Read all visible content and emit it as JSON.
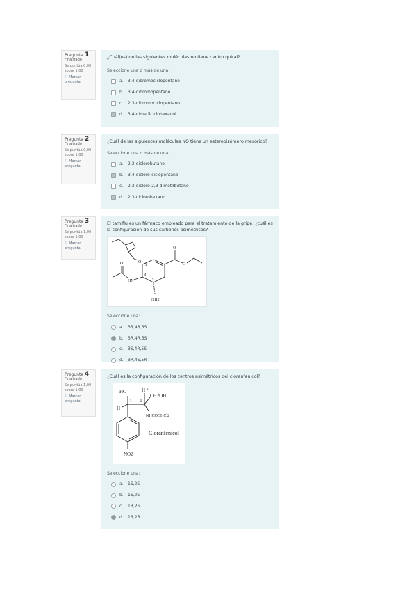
{
  "questions": [
    {
      "label": "Pregunta",
      "number": "1",
      "state": "Finalizado",
      "mark": "Se puntúa 0,00 sobre 1,00",
      "flag": "Marcar pregunta",
      "text": "¿Cuál(es) de las siguientes moléculas no tiene centro quiral?",
      "prompt": "Seleccione una o más de una:",
      "answers": [
        {
          "letter": "a.",
          "text": "3,4-dibromociclopentano"
        },
        {
          "letter": "b.",
          "text": "3,4-dibromopentano"
        },
        {
          "letter": "c.",
          "text": "2,3-dibromociclopentano"
        },
        {
          "letter": "d.",
          "text": "3,4-dimetilciclohexanol"
        }
      ]
    },
    {
      "label": "Pregunta",
      "number": "2",
      "state": "Finalizado",
      "mark": "Se puntúa 0,00 sobre 1,00",
      "flag": "Marcar pregunta",
      "text": "¿Cuál de las siguientes moléculas NO tiene un estereoisómero mesórico?",
      "prompt": "Seleccione una o más de una:",
      "answers": [
        {
          "letter": "a.",
          "text": "2,3-diclorobutano"
        },
        {
          "letter": "b.",
          "text": "3,4-dicloro-ciclopentano"
        },
        {
          "letter": "c.",
          "text": "2,3-dicloro-2,3-dimetilbutano"
        },
        {
          "letter": "d.",
          "text": "2,3-diclorohexano"
        }
      ]
    },
    {
      "label": "Pregunta",
      "number": "3",
      "state": "Finalizado",
      "mark": "Se puntúa 1,00 sobre 1,00",
      "flag": "Marcar pregunta",
      "text": "El tamiflu es un fármaco empleado para el tratamiento de la gripe, ¿cuál es la configuración de sus carbonos asimétricos?",
      "prompt": "Seleccione una:",
      "answers": [
        {
          "letter": "a.",
          "text": "3R,4R,5S"
        },
        {
          "letter": "b.",
          "text": "3R,4R,5S"
        },
        {
          "letter": "c.",
          "text": "3S,4R,5S"
        },
        {
          "letter": "d.",
          "text": "3R,4S,5R"
        }
      ],
      "diagram": {
        "atoms": {
          "O_ether": "O",
          "N_amide": "HN",
          "N_amine": "NH2",
          "O_ester": "O",
          "O_carbonyl": "O"
        },
        "locants": [
          "3",
          "4",
          "5"
        ]
      }
    },
    {
      "label": "Pregunta",
      "number": "4",
      "state": "Finalizado",
      "mark": "Se puntúa 1,00 sobre 1,00",
      "flag": "Marcar pregunta",
      "text": "¿Cuál es la configuración de los centros asimétricos del cloranfenicol?",
      "prompt": "Seleccione una:",
      "answers": [
        {
          "letter": "a.",
          "text": "1S,2S"
        },
        {
          "letter": "b.",
          "text": "1S,2S"
        },
        {
          "letter": "c.",
          "text": "1R,2S"
        },
        {
          "letter": "d.",
          "text": "1R,2R"
        }
      ],
      "diagram": {
        "name": "Cloranfenicol",
        "labels": {
          "ho": "HO",
          "h_top": "H",
          "h_left": "H",
          "ch2oh": "CH2OH",
          "nh": "NHCOCHCl2",
          "no2": "NO2"
        },
        "locants": [
          "3",
          "1",
          "2"
        ]
      }
    }
  ],
  "colors": {
    "content_bg": "#e7f3f5",
    "info_bg": "#f7f7f7"
  }
}
